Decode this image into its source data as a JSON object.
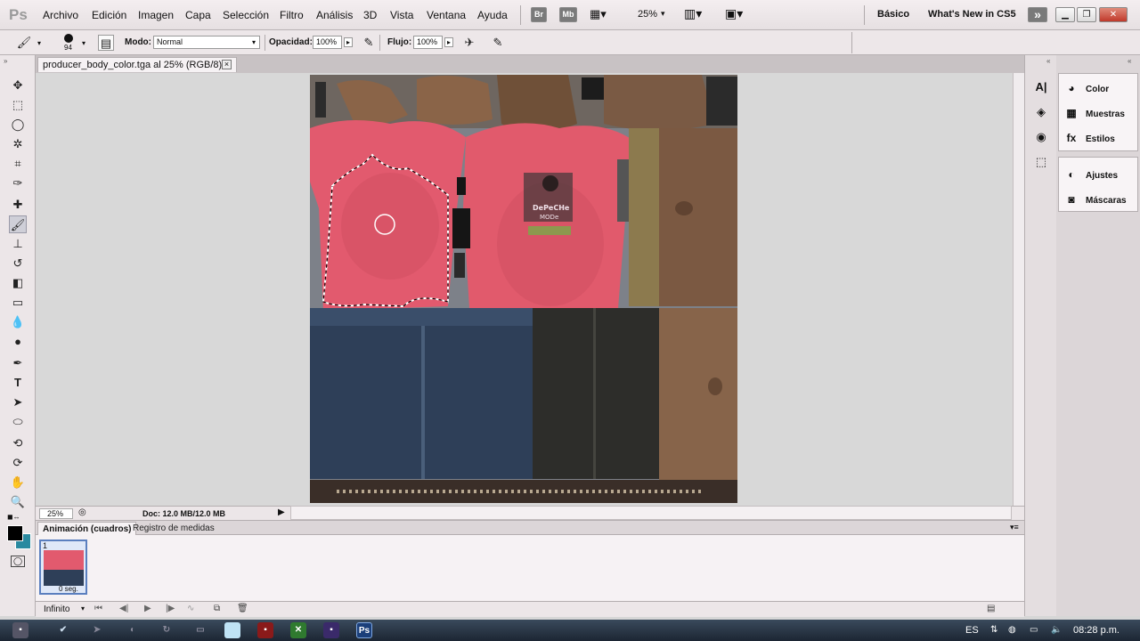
{
  "app": {
    "logo": "Ps",
    "menus": [
      "Archivo",
      "Edición",
      "Imagen",
      "Capa",
      "Selección",
      "Filtro",
      "Análisis",
      "3D",
      "Vista",
      "Ventana",
      "Ayuda"
    ],
    "bridge_label": "Br",
    "minibridge_label": "Mb",
    "zoom": "25%",
    "workspace": "Básico",
    "whats_new": "What's New in CS5",
    "expand_glyph": "»"
  },
  "options": {
    "brush_size": "94",
    "mode_label": "Modo:",
    "mode_value": "Normal",
    "opacity_label": "Opacidad:",
    "opacity_value": "100%",
    "flow_label": "Flujo:",
    "flow_value": "100%"
  },
  "document": {
    "tab_title": "producer_body_color.tga al 25% (RGB/8)",
    "close_glyph": "×",
    "shirt_logo_line1": "DePeCHe",
    "shirt_logo_line2": "MODe"
  },
  "status": {
    "zoom": "25%",
    "doc_info": "Doc: 12.0 MB/12.0 MB"
  },
  "animation": {
    "tab_active": "Animación (cuadros)",
    "tab_other": "Registro de medidas",
    "frame_number": "1",
    "frame_delay": "0 seg.",
    "loop": "Infinito"
  },
  "panels": {
    "group1": [
      "Color",
      "Muestras",
      "Estilos"
    ],
    "group2": [
      "Ajustes",
      "Máscaras"
    ]
  },
  "taskbar": {
    "lang": "ES",
    "clock": "08:28 p.m."
  },
  "colors": {
    "accent": "#5a7fbf",
    "shirt_pink": "#e25a6e",
    "jeans_blue": "#2e3f58",
    "skin": "#8a6448"
  }
}
